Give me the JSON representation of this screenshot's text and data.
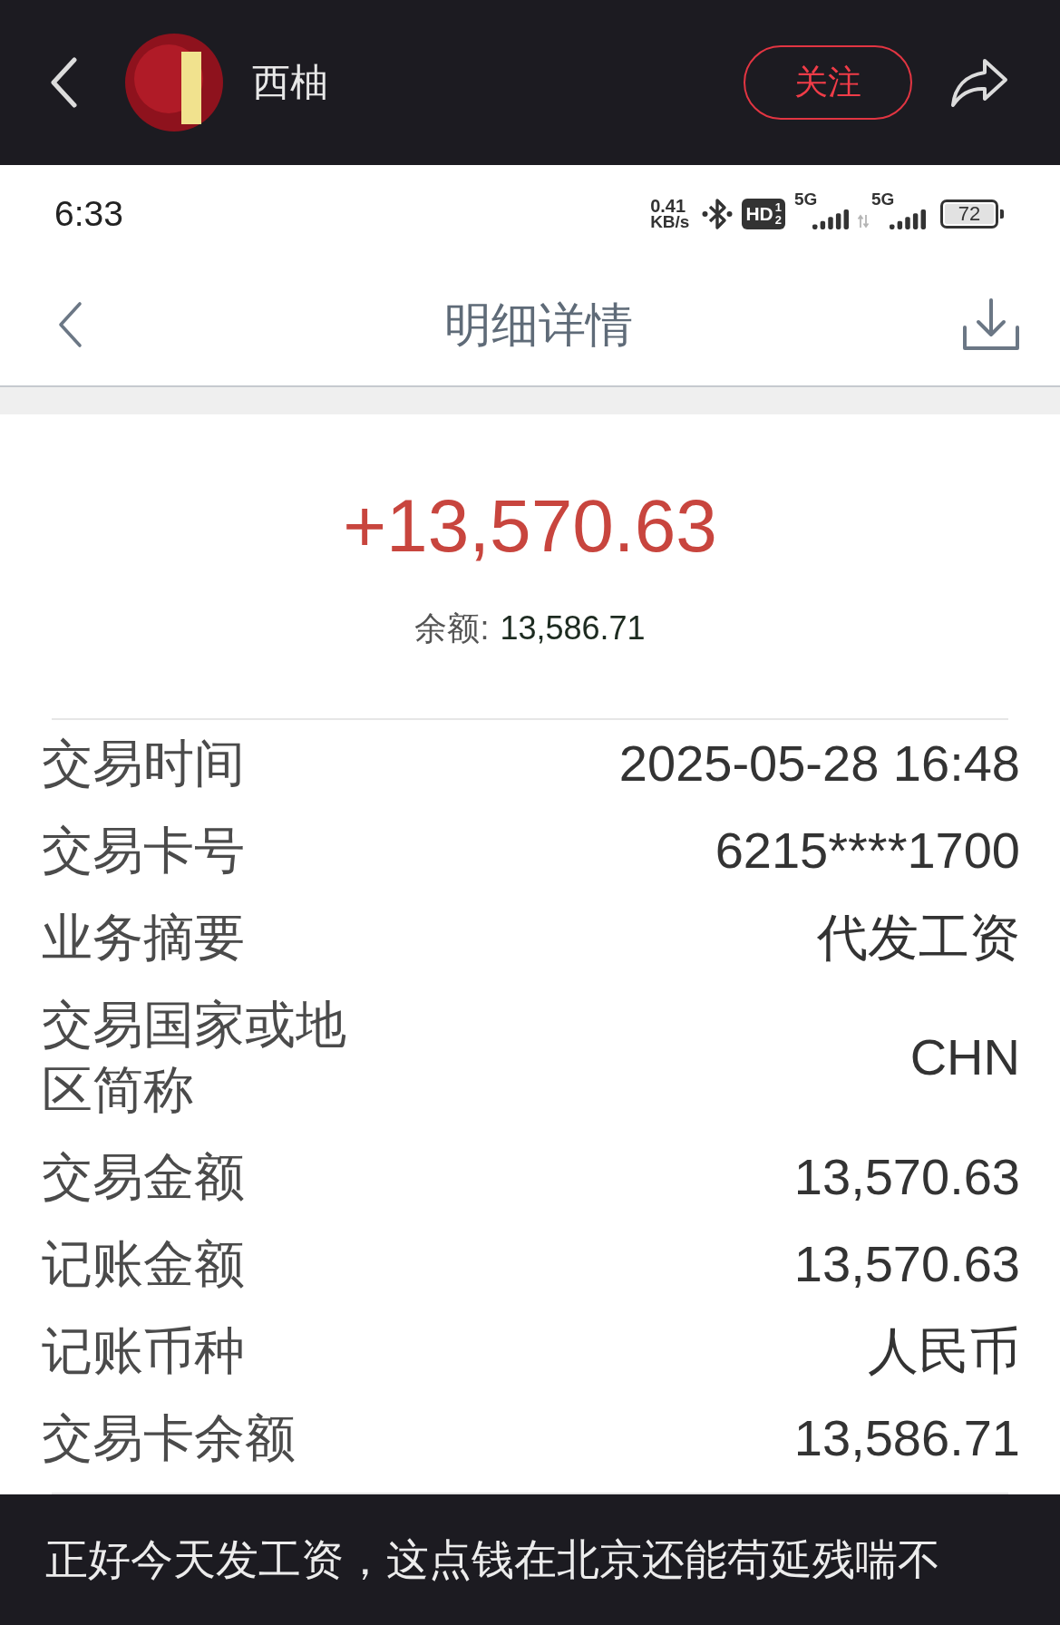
{
  "top_bar": {
    "account_name": "西柚",
    "follow_button": "关注"
  },
  "status_bar": {
    "time": "6:33",
    "speed_value": "0.41",
    "speed_unit": "KB/s",
    "hd_label": "HD",
    "hd_sims": [
      "1",
      "2"
    ],
    "signals": [
      {
        "label": "5G",
        "data_activity": false
      },
      {
        "label": "5G",
        "data_activity": true
      }
    ],
    "battery": "72"
  },
  "nav": {
    "title": "明细详情"
  },
  "summary": {
    "amount": "+13,570.63",
    "balance_label": "余额:",
    "balance_value": "13,586.71"
  },
  "details": [
    {
      "label": "交易时间",
      "value": "2025-05-28 16:48"
    },
    {
      "label": "交易卡号",
      "value": "6215****1700"
    },
    {
      "label": "业务摘要",
      "value": "代发工资"
    },
    {
      "label": "交易国家或地区简称",
      "value": "CHN"
    },
    {
      "label": "交易金额",
      "value": "13,570.63"
    },
    {
      "label": "记账金额",
      "value": "13,570.63"
    },
    {
      "label": "记账币种",
      "value": "人民币"
    },
    {
      "label": "交易卡余额",
      "value": "13,586.71"
    }
  ],
  "post": {
    "text": "正好今天发工资，这点钱在北京还能苟延残喘不"
  }
}
